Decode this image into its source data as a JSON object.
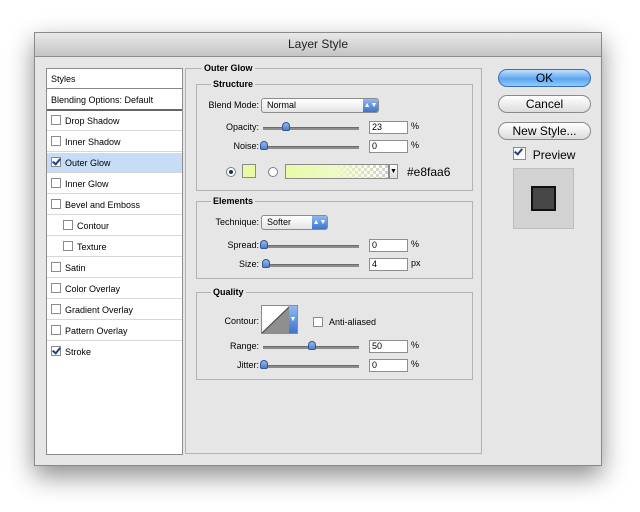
{
  "window": {
    "title": "Layer Style"
  },
  "styles_list": [
    {
      "label": "Styles",
      "has_checkbox": false,
      "checked": false,
      "selected": false
    },
    {
      "label": "Blending Options: Default",
      "has_checkbox": false,
      "checked": false,
      "selected": false
    },
    {
      "label": "Drop Shadow",
      "has_checkbox": true,
      "checked": false,
      "selected": false
    },
    {
      "label": "Inner Shadow",
      "has_checkbox": true,
      "checked": false,
      "selected": false
    },
    {
      "label": "Outer Glow",
      "has_checkbox": true,
      "checked": true,
      "selected": true
    },
    {
      "label": "Inner Glow",
      "has_checkbox": true,
      "checked": false,
      "selected": false
    },
    {
      "label": "Bevel and Emboss",
      "has_checkbox": true,
      "checked": false,
      "selected": false
    },
    {
      "label": "Contour",
      "has_checkbox": true,
      "checked": false,
      "selected": false
    },
    {
      "label": "Texture",
      "has_checkbox": true,
      "checked": false,
      "selected": false
    },
    {
      "label": "Satin",
      "has_checkbox": true,
      "checked": false,
      "selected": false
    },
    {
      "label": "Color Overlay",
      "has_checkbox": true,
      "checked": false,
      "selected": false
    },
    {
      "label": "Gradient Overlay",
      "has_checkbox": true,
      "checked": false,
      "selected": false
    },
    {
      "label": "Pattern Overlay",
      "has_checkbox": true,
      "checked": false,
      "selected": false
    },
    {
      "label": "Stroke",
      "has_checkbox": true,
      "checked": true,
      "selected": false
    }
  ],
  "outer_glow": {
    "title": "Outer Glow",
    "structure": {
      "title": "Structure",
      "blend_mode_label": "Blend Mode:",
      "blend_mode_value": "Normal",
      "opacity_label": "Opacity:",
      "opacity_value": "23",
      "opacity_unit": "%",
      "opacity_fraction": 0.23,
      "noise_label": "Noise:",
      "noise_value": "0",
      "noise_unit": "%",
      "noise_fraction": 0,
      "glow_color_hex": "#e8faa6",
      "color_label": "#e8faa6"
    },
    "elements": {
      "title": "Elements",
      "technique_label": "Technique:",
      "technique_value": "Softer",
      "spread_label": "Spread:",
      "spread_value": "0",
      "spread_unit": "%",
      "spread_fraction": 0,
      "size_label": "Size:",
      "size_value": "4",
      "size_unit": "px",
      "size_fraction": 0.016
    },
    "quality": {
      "title": "Quality",
      "contour_label": "Contour:",
      "anti_aliased_label": "Anti-aliased",
      "anti_aliased_checked": false,
      "range_label": "Range:",
      "range_value": "50",
      "range_unit": "%",
      "range_fraction": 0.5,
      "jitter_label": "Jitter:",
      "jitter_value": "0",
      "jitter_unit": "%",
      "jitter_fraction": 0
    }
  },
  "buttons": {
    "ok": "OK",
    "cancel": "Cancel",
    "new_style": "New Style...",
    "preview_label": "Preview",
    "preview_checked": true
  },
  "colors": {
    "selection": "#c7ddf7",
    "accent": "#5ea6ef",
    "preview_swatch": "#474747"
  }
}
